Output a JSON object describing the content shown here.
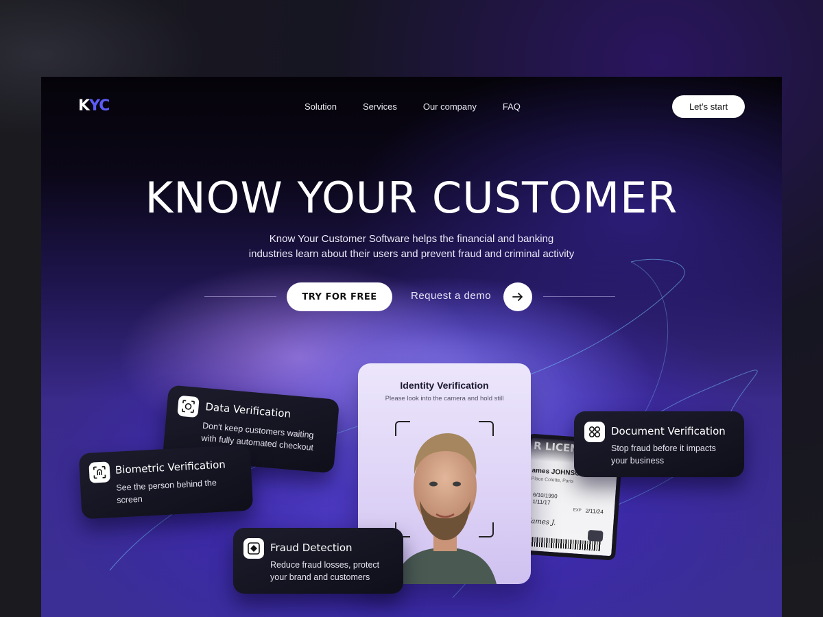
{
  "logo": {
    "k": "K",
    "yc": "YC"
  },
  "nav": {
    "items": [
      "Solution",
      "Services",
      "Our company",
      "FAQ"
    ],
    "cta": "Let’s start"
  },
  "hero": {
    "title": "KNOW YOUR CUSTOMER",
    "subtitle_line1": "Know Your Customer Software helps the financial and banking",
    "subtitle_line2": "industries learn about their users and prevent fraud and criminal activity",
    "try_button": "TRY FOR FREE",
    "demo_text": "Request a demo"
  },
  "phone": {
    "title": "Identity Verification",
    "subtitle": "Please look into the camera and hold still"
  },
  "id_card": {
    "header": "R LICENSE",
    "name": "ames JOHNSON",
    "address": "Place Colette, Paris",
    "dob": "6/10/1990",
    "issued": "1/11/17",
    "exp_label": "EXP",
    "exp": "2/11/24",
    "signature": "James J."
  },
  "cards": {
    "data": {
      "title": "Data Verification",
      "desc": "Don't keep customers waiting with fully automated checkout",
      "icon": "scan-face-icon"
    },
    "bio": {
      "title": "Biometric Verification",
      "desc": "See the person behind the screen",
      "icon": "fingerprint-scan-icon"
    },
    "fraud": {
      "title": "Fraud Detection",
      "desc": "Reduce fraud losses, protect your brand and customers",
      "icon": "shield-frame-icon"
    },
    "doc": {
      "title": "Document Verification",
      "desc": "Stop fraud before it impacts your business",
      "icon": "four-circles-icon"
    }
  },
  "colors": {
    "accent": "#5b5cf5",
    "background": "#161522",
    "card": "#14131f"
  }
}
